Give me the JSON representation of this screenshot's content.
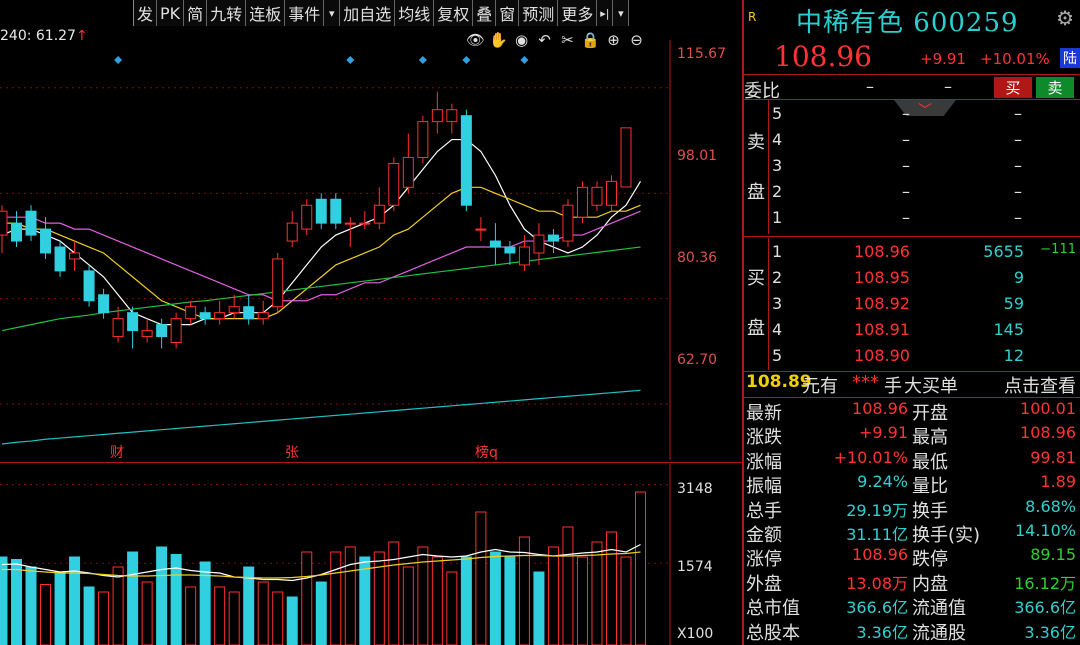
{
  "toolbar": {
    "items": [
      "发",
      "PK",
      "简",
      "九转",
      "连板",
      "事件",
      "▾",
      "加自选",
      "均线",
      "复权",
      "叠",
      "窗",
      "预测",
      "更多",
      "▸|",
      "▾"
    ]
  },
  "ma_readout": {
    "text": "240: 61.27",
    "arrow": "↑"
  },
  "tool_icons": [
    "eye-icon",
    "hand-icon",
    "play-circle-icon",
    "undo-icon",
    "scissors-icon",
    "lock-icon",
    "zoom-in-icon",
    "zoom-out-icon"
  ],
  "price_axis": [
    "115.67",
    "98.01",
    "80.36",
    "62.70"
  ],
  "volume_axis": [
    "3148",
    "1574",
    "X100"
  ],
  "event_markers": [
    "财",
    "张",
    "榜q"
  ],
  "chart_data": [
    {
      "type": "candlestick",
      "ylim": [
        55,
        122
      ],
      "price_axis_ticks": [
        115.67,
        98.01,
        80.36,
        62.7
      ],
      "candles": [
        {
          "o": 91,
          "c": 95,
          "h": 96,
          "l": 88
        },
        {
          "o": 93,
          "c": 90,
          "h": 95,
          "l": 89
        },
        {
          "o": 95,
          "c": 91,
          "h": 96,
          "l": 90
        },
        {
          "o": 92,
          "c": 88,
          "h": 94,
          "l": 87
        },
        {
          "o": 89,
          "c": 85,
          "h": 90,
          "l": 84
        },
        {
          "o": 87,
          "c": 88,
          "h": 90,
          "l": 85
        },
        {
          "o": 85,
          "c": 80,
          "h": 86,
          "l": 79
        },
        {
          "o": 81,
          "c": 78,
          "h": 82,
          "l": 77
        },
        {
          "o": 74,
          "c": 77,
          "h": 79,
          "l": 73
        },
        {
          "o": 78,
          "c": 75,
          "h": 79,
          "l": 72
        },
        {
          "o": 74,
          "c": 75,
          "h": 77,
          "l": 73
        },
        {
          "o": 76,
          "c": 74,
          "h": 77,
          "l": 72
        },
        {
          "o": 73,
          "c": 77,
          "h": 78,
          "l": 72
        },
        {
          "o": 77,
          "c": 79,
          "h": 80,
          "l": 76
        },
        {
          "o": 78,
          "c": 77,
          "h": 79,
          "l": 76
        },
        {
          "o": 77,
          "c": 78,
          "h": 80,
          "l": 76
        },
        {
          "o": 78,
          "c": 79,
          "h": 81,
          "l": 77
        },
        {
          "o": 79,
          "c": 77,
          "h": 81,
          "l": 76
        },
        {
          "o": 77,
          "c": 78,
          "h": 80,
          "l": 76
        },
        {
          "o": 79,
          "c": 87,
          "h": 88,
          "l": 78
        },
        {
          "o": 90,
          "c": 93,
          "h": 95,
          "l": 89
        },
        {
          "o": 92,
          "c": 96,
          "h": 97,
          "l": 91
        },
        {
          "o": 97,
          "c": 93,
          "h": 98,
          "l": 92
        },
        {
          "o": 97,
          "c": 93,
          "h": 98,
          "l": 92
        },
        {
          "o": 93,
          "c": 93,
          "h": 94,
          "l": 89
        },
        {
          "o": 93,
          "c": 93,
          "h": 95,
          "l": 92
        },
        {
          "o": 93,
          "c": 96,
          "h": 99,
          "l": 92
        },
        {
          "o": 96,
          "c": 103,
          "h": 104,
          "l": 95
        },
        {
          "o": 99,
          "c": 104,
          "h": 108,
          "l": 98
        },
        {
          "o": 104,
          "c": 110,
          "h": 111,
          "l": 103
        },
        {
          "o": 110,
          "c": 112,
          "h": 115,
          "l": 108
        },
        {
          "o": 110,
          "c": 112,
          "h": 113,
          "l": 108
        },
        {
          "o": 111,
          "c": 96,
          "h": 112,
          "l": 95
        },
        {
          "o": 92,
          "c": 92,
          "h": 94,
          "l": 90
        },
        {
          "o": 90,
          "c": 89,
          "h": 93,
          "l": 86
        },
        {
          "o": 89,
          "c": 88,
          "h": 90,
          "l": 86
        },
        {
          "o": 86,
          "c": 89,
          "h": 91,
          "l": 85
        },
        {
          "o": 88,
          "c": 91,
          "h": 93,
          "l": 86
        },
        {
          "o": 91,
          "c": 90,
          "h": 92,
          "l": 88
        },
        {
          "o": 90,
          "c": 96,
          "h": 97,
          "l": 89
        },
        {
          "o": 94,
          "c": 99,
          "h": 100,
          "l": 93
        },
        {
          "o": 96,
          "c": 99,
          "h": 100,
          "l": 95
        },
        {
          "o": 96,
          "c": 100,
          "h": 101,
          "l": 95
        },
        {
          "o": 99.06,
          "c": 108.96,
          "h": 108.96,
          "l": 99.06
        }
      ],
      "ma_series": [
        {
          "color": "#ffffff",
          "values": [
            91,
            92,
            92,
            91,
            90,
            88,
            86,
            84,
            81,
            78,
            77,
            76,
            76,
            76,
            77,
            77,
            78,
            78,
            78,
            80,
            83,
            86,
            89,
            91,
            92,
            93,
            94,
            96,
            99,
            102,
            105,
            107,
            107,
            105,
            101,
            96,
            92,
            90,
            89,
            88,
            89,
            91,
            94,
            96,
            100
          ]
        },
        {
          "color": "#f0d020",
          "values": [
            93,
            93,
            92,
            92,
            91,
            90,
            89,
            88,
            86,
            84,
            82,
            80,
            79,
            78,
            77,
            77,
            77,
            77,
            77,
            78,
            80,
            82,
            84,
            86,
            87,
            88,
            89,
            91,
            92,
            94,
            96,
            98,
            99,
            99,
            98,
            97,
            96,
            95,
            95,
            94,
            94,
            94,
            95,
            95,
            96
          ]
        },
        {
          "color": "#e060e0",
          "values": [
            94,
            94,
            94,
            93,
            93,
            92,
            92,
            91,
            90,
            89,
            88,
            87,
            86,
            85,
            84,
            83,
            82,
            81,
            81,
            80,
            80,
            80,
            81,
            81,
            82,
            83,
            83,
            84,
            85,
            86,
            87,
            88,
            89,
            89,
            89,
            89,
            90,
            90,
            90,
            91,
            91,
            92,
            93,
            94,
            95
          ]
        },
        {
          "color": "#20c040",
          "values": [
            75,
            75.5,
            76,
            76.5,
            77,
            77.3,
            77.6,
            78,
            78.3,
            78.6,
            78.9,
            79.2,
            79.5,
            79.8,
            80,
            80.3,
            80.6,
            80.9,
            81.2,
            81.5,
            81.8,
            82.1,
            82.4,
            82.7,
            83,
            83.3,
            83.6,
            83.9,
            84.2,
            84.5,
            84.8,
            85.1,
            85.4,
            85.7,
            86,
            86.3,
            86.6,
            86.9,
            87.2,
            87.5,
            87.8,
            88.1,
            88.4,
            88.7,
            89
          ]
        },
        {
          "color": "#20c0c0",
          "values": [
            56,
            56.3,
            56.5,
            56.8,
            57,
            57.2,
            57.4,
            57.6,
            57.8,
            58,
            58.2,
            58.4,
            58.6,
            58.8,
            59,
            59.2,
            59.4,
            59.6,
            59.8,
            60,
            60.2,
            60.4,
            60.6,
            60.8,
            61,
            61.2,
            61.4,
            61.6,
            61.8,
            62,
            62.2,
            62.4,
            62.6,
            62.8,
            63,
            63.2,
            63.4,
            63.6,
            63.8,
            64,
            64.2,
            64.4,
            64.6,
            64.8,
            65
          ]
        }
      ]
    },
    {
      "type": "bar",
      "ylim": [
        0,
        3400
      ],
      "volume_axis_ticks": [
        3148,
        1574
      ],
      "values": [
        1700,
        1650,
        1500,
        1150,
        1400,
        1700,
        1100,
        1000,
        1500,
        1800,
        1200,
        1900,
        1750,
        1100,
        1600,
        1100,
        1000,
        1500,
        1200,
        1000,
        900,
        1800,
        1200,
        1800,
        1900,
        1700,
        1800,
        2000,
        1500,
        1900,
        1700,
        1400,
        1700,
        2600,
        1800,
        1700,
        2100,
        1400,
        1900,
        2300,
        1700,
        2000,
        2200,
        1700,
        3000
      ],
      "up": [
        false,
        false,
        false,
        true,
        false,
        false,
        false,
        true,
        true,
        false,
        true,
        false,
        false,
        true,
        false,
        true,
        true,
        false,
        true,
        true,
        false,
        true,
        false,
        true,
        true,
        false,
        true,
        true,
        true,
        true,
        true,
        true,
        false,
        true,
        false,
        false,
        true,
        false,
        true,
        true,
        true,
        true,
        true,
        true,
        true
      ],
      "ma_lines": [
        {
          "color": "#ffffff",
          "values": [
            1550,
            1560,
            1500,
            1450,
            1400,
            1420,
            1380,
            1330,
            1300,
            1350,
            1400,
            1450,
            1480,
            1430,
            1400,
            1380,
            1300,
            1280,
            1250,
            1250,
            1230,
            1280,
            1350,
            1450,
            1550,
            1600,
            1620,
            1650,
            1700,
            1750,
            1720,
            1700,
            1720,
            1800,
            1850,
            1800,
            1790,
            1750,
            1720,
            1750,
            1780,
            1800,
            1850,
            1800,
            1950
          ]
        },
        {
          "color": "#f0d020",
          "values": [
            1450,
            1450,
            1420,
            1400,
            1380,
            1380,
            1370,
            1350,
            1330,
            1320,
            1320,
            1330,
            1340,
            1340,
            1330,
            1320,
            1300,
            1290,
            1280,
            1280,
            1290,
            1310,
            1340,
            1380,
            1420,
            1460,
            1500,
            1540,
            1570,
            1600,
            1620,
            1640,
            1660,
            1690,
            1710,
            1720,
            1730,
            1730,
            1720,
            1720,
            1730,
            1740,
            1760,
            1770,
            1800
          ]
        }
      ]
    }
  ],
  "quote": {
    "badge": "R",
    "name": "中稀有色",
    "code": "600259",
    "last": "108.96",
    "change": "+9.91",
    "change_pct": "+10.01%",
    "market_badge": "陆",
    "weibi_label": "委比",
    "weibi_dash1": "–",
    "weibi_dash2": "–",
    "buy_label": "买",
    "sell_label": "卖",
    "sell_side_label": [
      "卖",
      "盘"
    ],
    "buy_side_label": [
      "买",
      "盘"
    ],
    "asks": [
      {
        "level": "5",
        "price": "–",
        "vol": "–"
      },
      {
        "level": "4",
        "price": "–",
        "vol": "–"
      },
      {
        "level": "3",
        "price": "–",
        "vol": "–"
      },
      {
        "level": "2",
        "price": "–",
        "vol": "–"
      },
      {
        "level": "1",
        "price": "–",
        "vol": "–"
      }
    ],
    "bids": [
      {
        "level": "1",
        "price": "108.96",
        "vol": "5655",
        "delta": "−111"
      },
      {
        "level": "2",
        "price": "108.95",
        "vol": "9",
        "delta": ""
      },
      {
        "level": "3",
        "price": "108.92",
        "vol": "59",
        "delta": ""
      },
      {
        "level": "4",
        "price": "108.91",
        "vol": "145",
        "delta": ""
      },
      {
        "level": "5",
        "price": "108.90",
        "vol": "12",
        "delta": ""
      }
    ],
    "big_buy": {
      "price": "108.89",
      "unit": "元有",
      "stars": "***",
      "hand": "手",
      "label": "大买单",
      "view": "点击查看"
    },
    "stats": [
      {
        "k1": "最新",
        "v1": "108.96",
        "c1": "red",
        "k2": "开盘",
        "v2": "100.01",
        "c2": "red"
      },
      {
        "k1": "涨跌",
        "v1": "+9.91",
        "c1": "red",
        "k2": "最高",
        "v2": "108.96",
        "c2": "red"
      },
      {
        "k1": "涨幅",
        "v1": "+10.01%",
        "c1": "red",
        "k2": "最低",
        "v2": "99.81",
        "c2": "red"
      },
      {
        "k1": "振幅",
        "v1": "9.24%",
        "c1": "cyan",
        "k2": "量比",
        "v2": "1.89",
        "c2": "red"
      },
      {
        "k1": "总手",
        "v1": "29.19万",
        "c1": "cyan",
        "k2": "换手",
        "v2": "8.68%",
        "c2": "cyan"
      },
      {
        "k1": "金额",
        "v1": "31.11亿",
        "c1": "cyan",
        "k2": "换手(实)",
        "v2": "14.10%",
        "c2": "cyan"
      },
      {
        "k1": "涨停",
        "v1": "108.96",
        "c1": "red",
        "k2": "跌停",
        "v2": "89.15",
        "c2": "green"
      },
      {
        "k1": "外盘",
        "v1": "13.08万",
        "c1": "red",
        "k2": "内盘",
        "v2": "16.12万",
        "c2": "green"
      },
      {
        "k1": "总市值",
        "v1": "366.6亿",
        "c1": "cyan",
        "k2": "流通值",
        "v2": "366.6亿",
        "c2": "cyan"
      },
      {
        "k1": "总股本",
        "v1": "3.36亿",
        "c1": "cyan",
        "k2": "流通股",
        "v2": "3.36亿",
        "c2": "cyan"
      }
    ]
  }
}
